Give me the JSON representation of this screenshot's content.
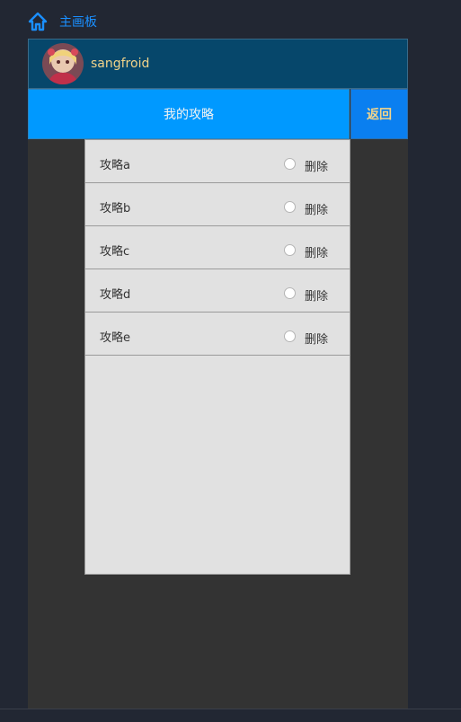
{
  "nav": {
    "home_icon": "home-icon",
    "breadcrumb": "主画板"
  },
  "user": {
    "name": "sangfroid",
    "avatar": "anime-avatar"
  },
  "header": {
    "title": "我的攻略",
    "back_label": "返回"
  },
  "items": [
    {
      "label": "攻略a",
      "delete_label": "删除"
    },
    {
      "label": "攻略b",
      "delete_label": "删除"
    },
    {
      "label": "攻略c",
      "delete_label": "删除"
    },
    {
      "label": "攻略d",
      "delete_label": "删除"
    },
    {
      "label": "攻略e",
      "delete_label": "删除"
    }
  ],
  "colors": {
    "accent": "#0099ff",
    "user_bar": "#06476b",
    "back": "#0a7ff0",
    "highlight_text": "#f2d48a"
  }
}
